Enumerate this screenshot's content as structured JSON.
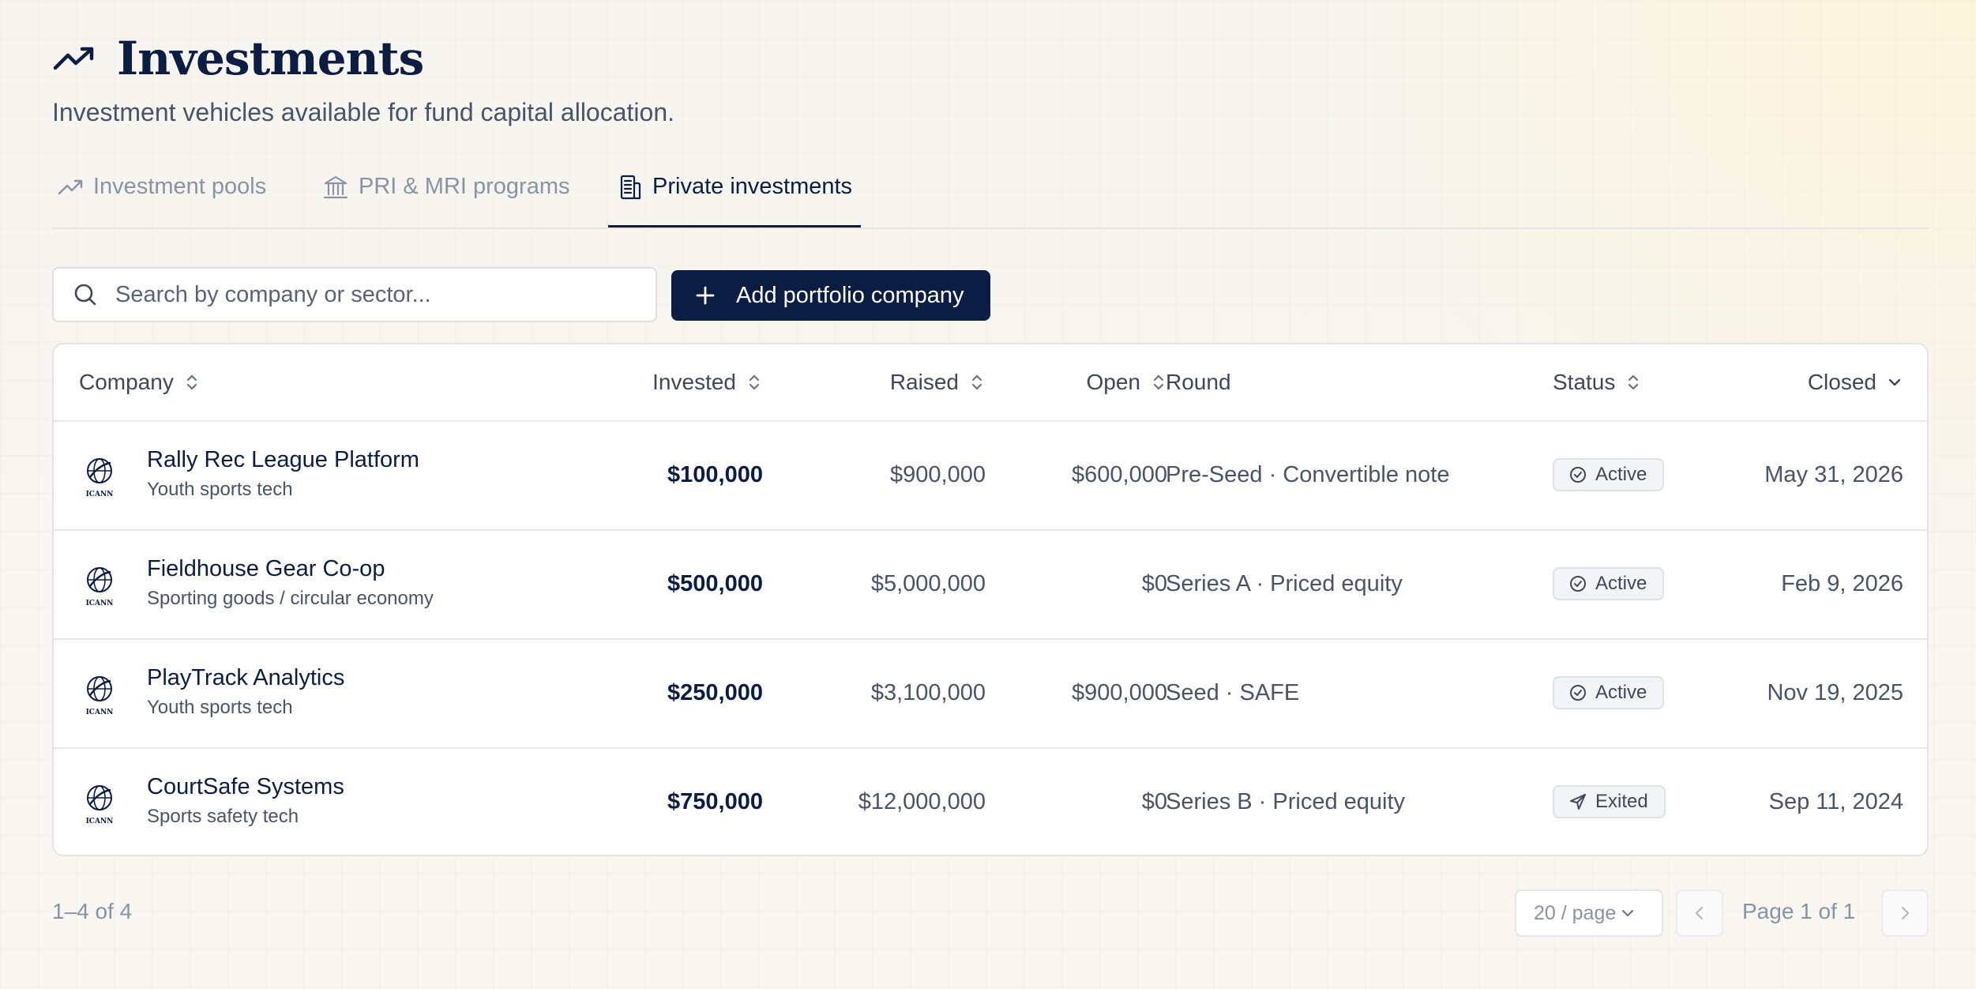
{
  "header": {
    "title": "Investments",
    "subtitle": "Investment vehicles available for fund capital allocation.",
    "icon": "trending-up-icon"
  },
  "tabs": [
    {
      "label": "Investment pools",
      "icon": "trending-up-icon",
      "active": false
    },
    {
      "label": "PRI & MRI programs",
      "icon": "bank-icon",
      "active": false
    },
    {
      "label": "Private investments",
      "icon": "building-icon",
      "active": true
    }
  ],
  "toolbar": {
    "search_placeholder": "Search by company or sector...",
    "search_value": "",
    "add_label": "Add portfolio company"
  },
  "table": {
    "columns": {
      "company": "Company",
      "invested": "Invested",
      "raised": "Raised",
      "open": "Open",
      "round": "Round",
      "status": "Status",
      "closed": "Closed"
    },
    "rows": [
      {
        "logo": "ICANN",
        "name": "Rally Rec League Platform",
        "sector": "Youth sports tech",
        "invested": "$100,000",
        "raised": "$900,000",
        "open": "$600,000",
        "round": "Pre-Seed · Convertible note",
        "status": "Active",
        "closed": "May 31, 2026"
      },
      {
        "logo": "ICANN",
        "name": "Fieldhouse Gear Co-op",
        "sector": "Sporting goods / circular economy",
        "invested": "$500,000",
        "raised": "$5,000,000",
        "open": "$0",
        "round": "Series A · Priced equity",
        "status": "Active",
        "closed": "Feb 9, 2026"
      },
      {
        "logo": "ICANN",
        "name": "PlayTrack Analytics",
        "sector": "Youth sports tech",
        "invested": "$250,000",
        "raised": "$3,100,000",
        "open": "$900,000",
        "round": "Seed · SAFE",
        "status": "Active",
        "closed": "Nov 19, 2025"
      },
      {
        "logo": "ICANN",
        "name": "CourtSafe Systems",
        "sector": "Sports safety tech",
        "invested": "$750,000",
        "raised": "$12,000,000",
        "open": "$0",
        "round": "Series B · Priced equity",
        "status": "Exited",
        "closed": "Sep 11, 2024"
      }
    ]
  },
  "footer": {
    "count": "1–4 of 4",
    "per_page": "20 / page",
    "page_label": "Page 1 of 1"
  },
  "colors": {
    "primary": "#0c1d44",
    "muted": "#8a93a4",
    "text": "#4a5468",
    "border": "#e4e4e6"
  }
}
